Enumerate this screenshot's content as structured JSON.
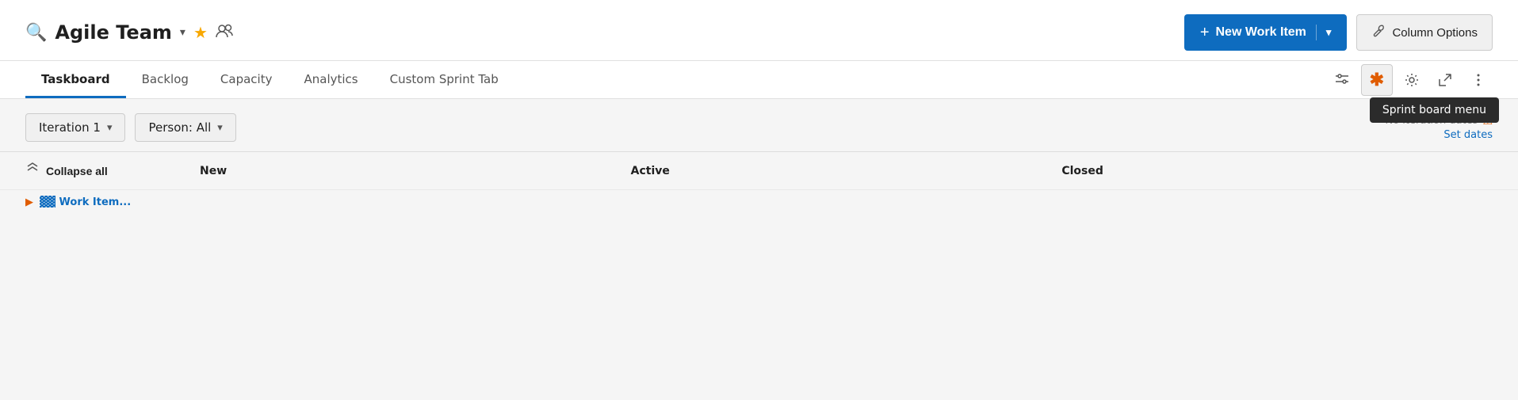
{
  "header": {
    "team_icon": "🔍",
    "team_name": "Agile Team",
    "chevron_label": "▾",
    "star_icon": "★",
    "team_members_icon": "👥",
    "new_work_item_label": "New Work Item",
    "new_work_item_plus": "+",
    "new_work_item_chevron": "▾",
    "column_options_label": "Column Options",
    "wrench_icon": "🔧"
  },
  "tabs": [
    {
      "label": "Taskboard",
      "active": true
    },
    {
      "label": "Backlog",
      "active": false
    },
    {
      "label": "Capacity",
      "active": false
    },
    {
      "label": "Analytics",
      "active": false
    },
    {
      "label": "Custom Sprint Tab",
      "active": false
    }
  ],
  "tab_bar_icons": {
    "filter_icon": "⚙",
    "asterisk": "*",
    "settings_icon": "⚙",
    "expand_icon": "↗",
    "more_icon": "⋮",
    "tooltip_text": "Sprint board menu"
  },
  "filters": {
    "iteration_label": "Iteration 1",
    "iteration_chevron": "▾",
    "person_label": "Person: All",
    "person_chevron": "▾"
  },
  "sprint_info": {
    "no_iteration_text": "No iteration dates",
    "set_dates_label": "Set dates",
    "alert_icon": "⚠"
  },
  "table": {
    "collapse_all_label": "Collapse all",
    "collapse_icon": "⇈",
    "col_new": "New",
    "col_active": "Active",
    "col_closed": "Closed"
  },
  "colors": {
    "accent_blue": "#0e6cbf",
    "accent_orange": "#e05c00",
    "active_tab_underline": "#0e6cbf",
    "tooltip_bg": "#2b2b2b"
  }
}
